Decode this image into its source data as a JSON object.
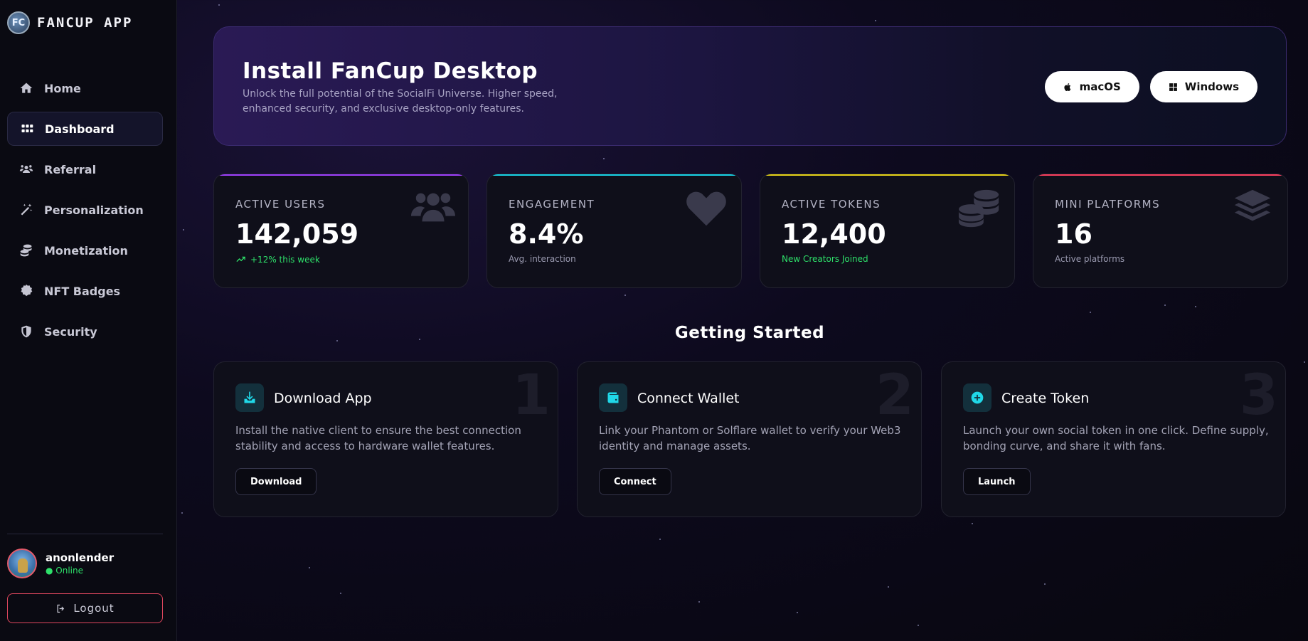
{
  "brand": {
    "logo_text": "FC",
    "name": "FANCUP APP"
  },
  "sidebar": {
    "items": [
      {
        "label": "Home",
        "icon": "home-icon",
        "active": false
      },
      {
        "label": "Dashboard",
        "icon": "grid-icon",
        "active": true
      },
      {
        "label": "Referral",
        "icon": "users-icon",
        "active": false
      },
      {
        "label": "Personalization",
        "icon": "magic-wand-icon",
        "active": false
      },
      {
        "label": "Monetization",
        "icon": "coins-icon",
        "active": false
      },
      {
        "label": "NFT Badges",
        "icon": "badge-icon",
        "active": false
      },
      {
        "label": "Security",
        "icon": "shield-icon",
        "active": false
      }
    ]
  },
  "user": {
    "name": "anonlender",
    "status": "● Online"
  },
  "logout_label": "Logout",
  "hero": {
    "title": "Install FanCup Desktop",
    "subtitle": "Unlock the full potential of the SocialFi Universe. Higher speed, enhanced security, and exclusive desktop-only features.",
    "mac_label": "macOS",
    "windows_label": "Windows"
  },
  "stats": [
    {
      "label": "ACTIVE USERS",
      "value": "142,059",
      "note": "+12% this week",
      "accent": "#a040ff",
      "icon": "users-icon"
    },
    {
      "label": "ENGAGEMENT",
      "value": "8.4%",
      "note": "Avg. interaction",
      "accent": "#18d4e8",
      "icon": "heart-pulse-icon"
    },
    {
      "label": "ACTIVE TOKENS",
      "value": "12,400",
      "note": "New Creators Joined",
      "accent": "#e8d418",
      "icon": "coins-icon"
    },
    {
      "label": "MINI PLATFORMS",
      "value": "16",
      "note": "Active platforms",
      "accent": "#ff4060",
      "icon": "layers-icon"
    }
  ],
  "getting_started": {
    "title": "Getting Started",
    "steps": [
      {
        "num": "1",
        "title": "Download App",
        "desc": "Install the native client to ensure the best connection stability and access to hardware wallet features.",
        "button": "Download",
        "icon": "download-icon"
      },
      {
        "num": "2",
        "title": "Connect Wallet",
        "desc": "Link your Phantom or Solflare wallet to verify your Web3 identity and manage assets.",
        "button": "Connect",
        "icon": "wallet-icon"
      },
      {
        "num": "3",
        "title": "Create Token",
        "desc": "Launch your own social token in one click. Define supply, bonding curve, and share it with fans.",
        "button": "Launch",
        "icon": "plus-circle-icon"
      }
    ]
  }
}
